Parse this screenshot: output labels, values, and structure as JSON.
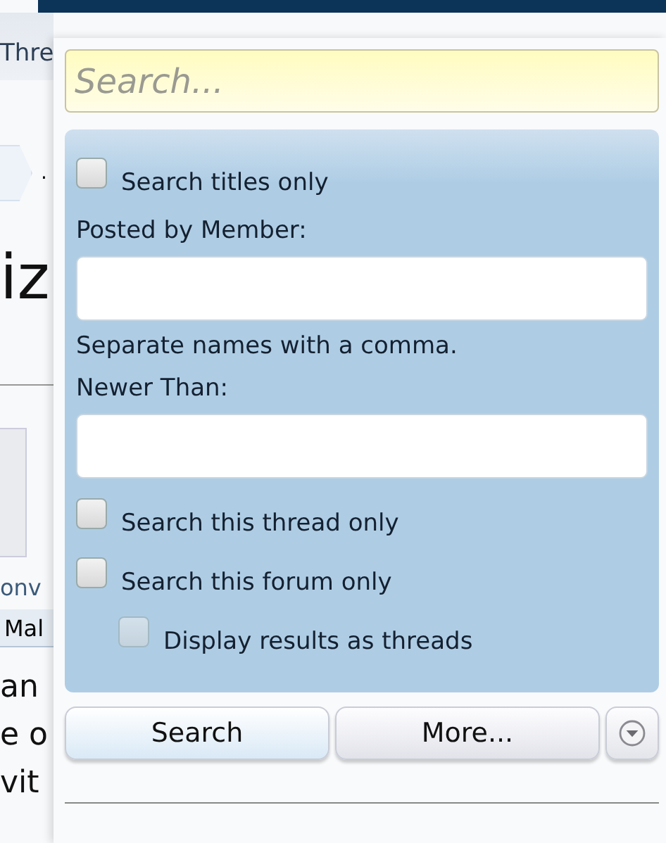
{
  "background": {
    "nav_text": "Thre",
    "breadcrumb_text": ".",
    "heading": "iz",
    "card_caption": "onv",
    "tag": "Mal",
    "body_lines": [
      "an",
      "e o",
      "vit"
    ]
  },
  "search_popup": {
    "search": {
      "placeholder": "Search..."
    },
    "options": [
      {
        "kind": "checkbox",
        "label": "Search titles only",
        "checked": false
      },
      {
        "kind": "label",
        "label": "Posted by Member:"
      },
      {
        "kind": "input"
      },
      {
        "kind": "hint",
        "label": "Separate names with a comma."
      },
      {
        "kind": "label",
        "label": "Newer Than:"
      },
      {
        "kind": "input"
      },
      {
        "kind": "checkbox",
        "label": "Search this thread only",
        "checked": false
      },
      {
        "kind": "checkbox",
        "label": "Search this forum only",
        "checked": false,
        "children": [
          {
            "kind": "checkbox",
            "label": "Display results as threads",
            "checked": false,
            "disabled": true
          }
        ]
      }
    ],
    "buttons": [
      {
        "label": "Search",
        "primary": true
      },
      {
        "label": "More...",
        "primary": false
      }
    ]
  }
}
